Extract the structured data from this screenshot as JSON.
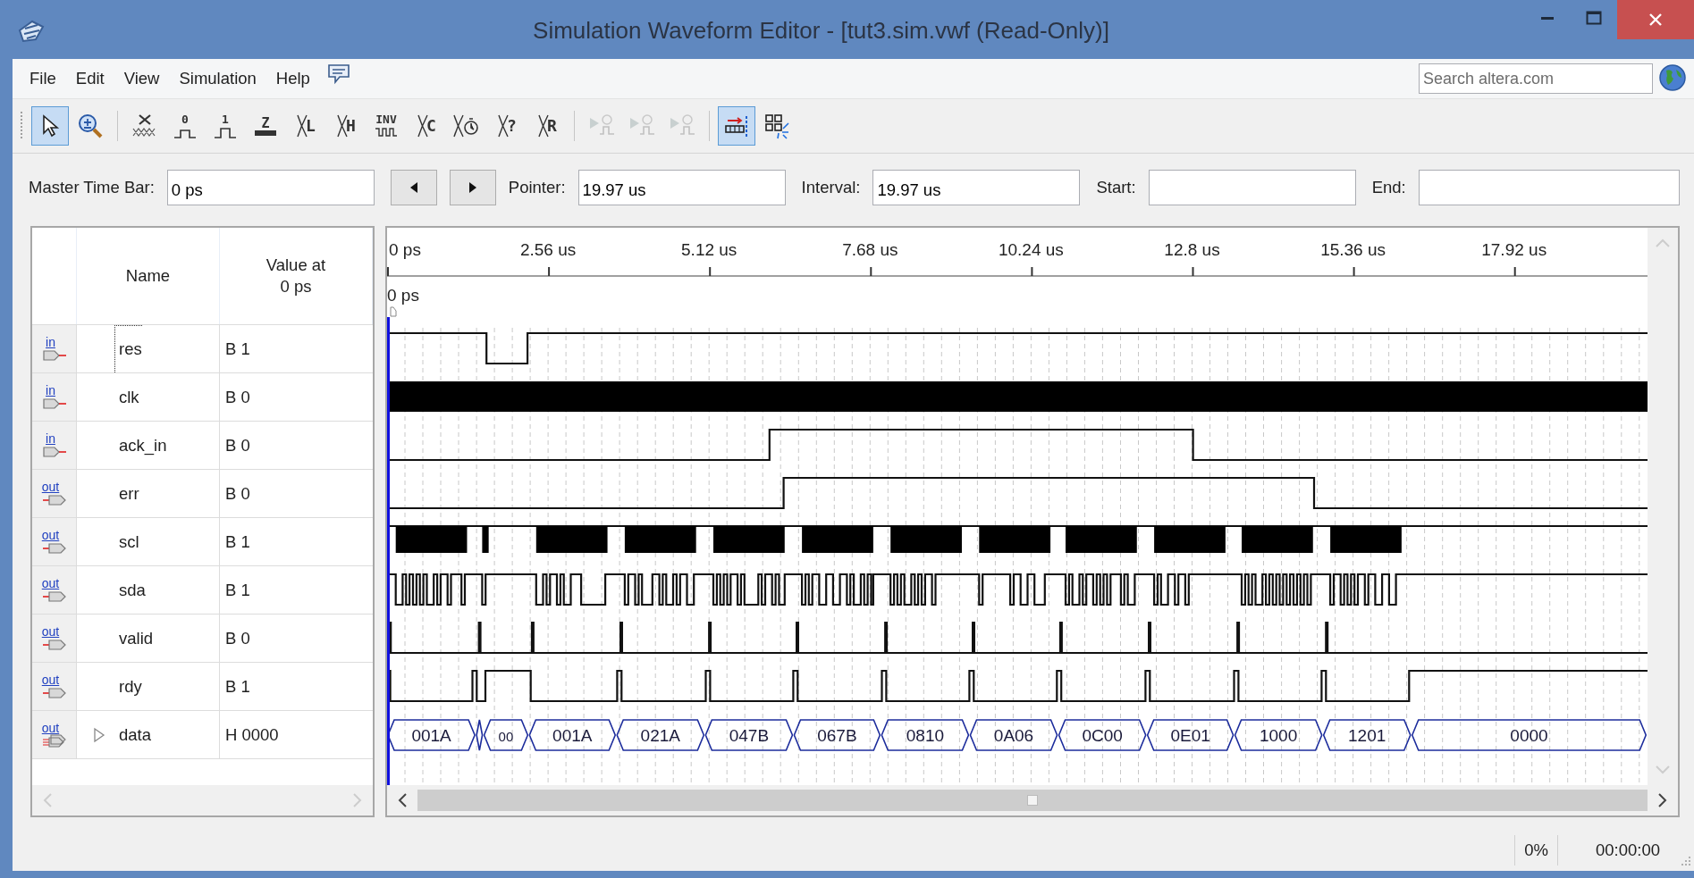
{
  "window": {
    "title": "Simulation Waveform Editor - [tut3.sim.vwf (Read-Only)]"
  },
  "menu": [
    "File",
    "Edit",
    "View",
    "Simulation",
    "Help"
  ],
  "search": {
    "placeholder": "Search altera.com"
  },
  "toolbar": [
    [
      {
        "kind": "pointer",
        "selected": true,
        "disabled": false
      },
      {
        "kind": "zoom",
        "selected": false,
        "disabled": false
      }
    ],
    [
      {
        "kind": "unknown",
        "selected": false,
        "disabled": false
      },
      {
        "kind": "low",
        "glyph": "0",
        "selected": false,
        "disabled": false
      },
      {
        "kind": "high",
        "glyph": "1",
        "selected": false,
        "disabled": false
      },
      {
        "kind": "hiz",
        "glyph": "Z",
        "selected": false,
        "disabled": false
      },
      {
        "kind": "cross",
        "glyph": "L",
        "selected": false,
        "disabled": false
      },
      {
        "kind": "cross",
        "glyph": "H",
        "selected": false,
        "disabled": false
      },
      {
        "kind": "invert",
        "glyph": "INV",
        "selected": false,
        "disabled": false
      },
      {
        "kind": "cross",
        "glyph": "C",
        "selected": false,
        "disabled": false
      },
      {
        "kind": "clock",
        "selected": false,
        "disabled": false
      },
      {
        "kind": "cross",
        "glyph": "?",
        "selected": false,
        "disabled": false
      },
      {
        "kind": "cross",
        "glyph": "R",
        "selected": false,
        "disabled": false
      }
    ],
    [
      {
        "kind": "run",
        "selected": false,
        "disabled": true
      },
      {
        "kind": "run",
        "selected": false,
        "disabled": true
      },
      {
        "kind": "run",
        "selected": false,
        "disabled": true
      }
    ],
    [
      {
        "kind": "snap",
        "selected": true,
        "disabled": false
      },
      {
        "kind": "grid",
        "selected": false,
        "disabled": false
      }
    ]
  ],
  "time_fields": [
    {
      "label": "Master Time Bar:",
      "value": "0 ps"
    },
    {
      "label": "Pointer:",
      "value": "19.97 us"
    },
    {
      "label": "Interval:",
      "value": "19.97 us"
    },
    {
      "label": "Start:"
    },
    {
      "label": "End:"
    }
  ],
  "table": {
    "columns": [
      "Name",
      "Value at\n0 ps"
    ]
  },
  "signals": [
    {
      "kind": "input",
      "direction": "in",
      "name": "res",
      "value": "B 1",
      "focused": true
    },
    {
      "kind": "input",
      "direction": "in",
      "name": "clk",
      "value": "B 0",
      "focused": false
    },
    {
      "kind": "input",
      "direction": "in",
      "name": "ack_in",
      "value": "B 0",
      "focused": false
    },
    {
      "kind": "output",
      "direction": "out",
      "name": "err",
      "value": "B 0",
      "focused": false
    },
    {
      "kind": "output",
      "direction": "out",
      "name": "scl",
      "value": "B 1",
      "focused": false
    },
    {
      "kind": "output",
      "direction": "out",
      "name": "sda",
      "value": "B 1",
      "focused": false
    },
    {
      "kind": "output",
      "direction": "out",
      "name": "valid",
      "value": "B 0",
      "focused": false
    },
    {
      "kind": "output",
      "direction": "out",
      "name": "rdy",
      "value": "B 1",
      "focused": false
    },
    {
      "kind": "bus",
      "direction": "out",
      "name": "data",
      "value": "H 0000",
      "focused": false,
      "expanded": false,
      "bus_values": [
        "001A",
        "00",
        "001A",
        "021A",
        "047B",
        "067B",
        "0810",
        "0A06",
        "0C00",
        "0E01",
        "1000",
        "1201",
        "0000"
      ]
    }
  ],
  "timeline": {
    "ticks": [
      "0 ps",
      "2.56 us",
      "5.12 us",
      "7.68 us",
      "10.24 us",
      "12.8 us",
      "15.36 us",
      "17.92 us"
    ],
    "marker": "0 ps"
  },
  "status_bar": {
    "progress": "0%",
    "elapsed": "00:00:00"
  }
}
